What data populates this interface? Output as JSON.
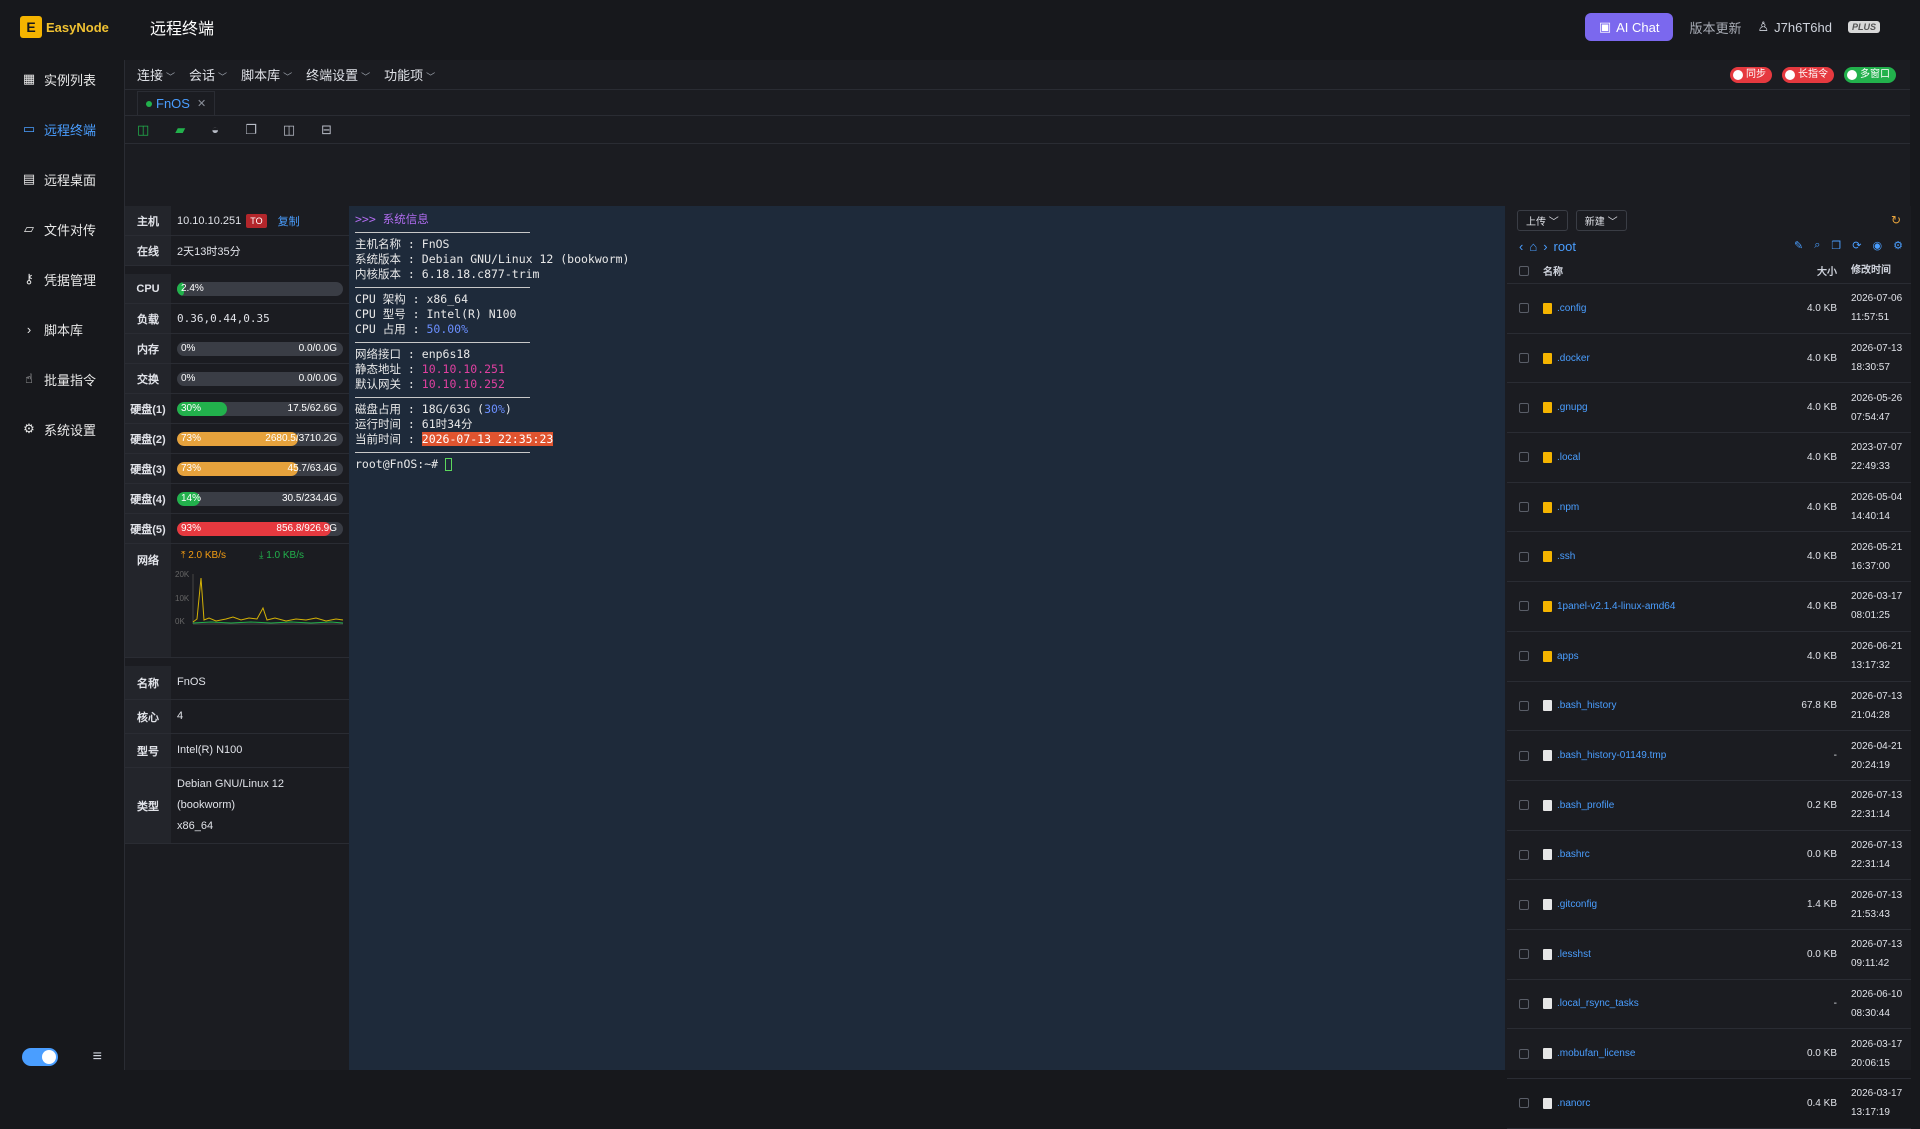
{
  "app": {
    "logo": "EasyNode",
    "logo_mark": "E",
    "title": "远程终端"
  },
  "topbar": {
    "ai_label": "AI Chat",
    "update_label": "版本更新",
    "user": "J7h6T6hd",
    "plan": "PLUS"
  },
  "sidebar": {
    "items": [
      {
        "label": "实例列表",
        "icon": "grid-icon"
      },
      {
        "label": "远程终端",
        "icon": "terminal-icon"
      },
      {
        "label": "远程桌面",
        "icon": "desktop-icon"
      },
      {
        "label": "文件对传",
        "icon": "folder-icon"
      },
      {
        "label": "凭据管理",
        "icon": "key-icon"
      },
      {
        "label": "脚本库",
        "icon": "chevron-right-icon"
      },
      {
        "label": "批量指令",
        "icon": "hand-icon"
      },
      {
        "label": "系统设置",
        "icon": "gear-icon"
      }
    ]
  },
  "menubar": {
    "items": [
      "连接",
      "会话",
      "脚本库",
      "终端设置",
      "功能项"
    ],
    "pills": [
      {
        "label": "同步",
        "on": false
      },
      {
        "label": "长指令",
        "on": false
      },
      {
        "label": "多窗口",
        "on": true
      }
    ]
  },
  "tab": {
    "label": "FnOS"
  },
  "host": {
    "host_label": "主机",
    "host": "10.10.10.251",
    "to": "TO",
    "copy": "复制",
    "online_label": "在线",
    "online": "2天13时35分",
    "cpu_label": "CPU",
    "cpu_pct": "2.4%",
    "load_label": "负载",
    "load": "0.36,0.44,0.35",
    "mem_label": "内存",
    "mem_pct": "0%",
    "mem_amt": "0.0/0.0G",
    "swap_label": "交换",
    "swap_pct": "0%",
    "swap_amt": "0.0/0.0G",
    "disks": [
      {
        "label": "硬盘(1)",
        "pct": "30%",
        "amt": "17.5/62.6G",
        "fill": 0.3,
        "color": "#22b14c"
      },
      {
        "label": "硬盘(2)",
        "pct": "73%",
        "amt": "2680.5/3710.2G",
        "fill": 0.73,
        "color": "#e6a23c"
      },
      {
        "label": "硬盘(3)",
        "pct": "73%",
        "amt": "45.7/63.4G",
        "fill": 0.73,
        "color": "#e6a23c"
      },
      {
        "label": "硬盘(4)",
        "pct": "14%",
        "amt": "30.5/234.4G",
        "fill": 0.14,
        "color": "#22b14c"
      },
      {
        "label": "硬盘(5)",
        "pct": "93%",
        "amt": "856.8/926.9G",
        "fill": 0.93,
        "color": "#e6393f"
      }
    ],
    "net_label": "网络",
    "net_up": "2.0 KB/s",
    "net_down": "1.0 KB/s",
    "net_ticks": [
      "20K",
      "10K",
      "0K"
    ]
  },
  "info": {
    "name_label": "名称",
    "name": "FnOS",
    "cores_label": "核心",
    "cores": "4",
    "model_label": "型号",
    "model": "Intel(R) N100",
    "type_label": "类型",
    "type": "Debian GNU/Linux 12 (bookworm)",
    "arch": "x86_64"
  },
  "terminal": {
    "header": ">>> 系统信息",
    "host_name": "主机名称 : FnOS",
    "os": "系统版本 : Debian GNU/Linux 12 (bookworm)",
    "kernel": "内核版本 : 6.18.18.c877-trim",
    "cpu_arch": "CPU 架构 : x86_64",
    "cpu_model": "CPU 型号 : Intel(R) N100",
    "cpu_use_label": "CPU 占用 : ",
    "cpu_use": "50.00%",
    "iface": "网络接口 : enp6s18",
    "ip_label": "静态地址 : ",
    "ip": "10.10.10.251",
    "gw_label": "默认网关 : ",
    "gw": "10.10.10.252",
    "disk_label": "磁盘占用 : 18G/63G (",
    "disk_pct": "30%",
    "disk_end": ")",
    "uptime": "运行时间 : 61时34分",
    "now_label": "当前时间 : ",
    "now": "2026-07-13 22:35:23",
    "prompt": "root@FnOS:~# "
  },
  "files": {
    "upload": "上传",
    "new": "新建",
    "path": "root",
    "col_name": "名称",
    "col_size": "大小",
    "col_time": "修改时间",
    "rows": [
      {
        "name": ".config",
        "type": "dir",
        "size": "4.0 KB",
        "date": "2026-07-06",
        "time": "11:57:51"
      },
      {
        "name": ".docker",
        "type": "dir",
        "size": "4.0 KB",
        "date": "2026-07-13",
        "time": "18:30:57"
      },
      {
        "name": ".gnupg",
        "type": "dir",
        "size": "4.0 KB",
        "date": "2026-05-26",
        "time": "07:54:47"
      },
      {
        "name": ".local",
        "type": "dir",
        "size": "4.0 KB",
        "date": "2023-07-07",
        "time": "22:49:33"
      },
      {
        "name": ".npm",
        "type": "dir",
        "size": "4.0 KB",
        "date": "2026-05-04",
        "time": "14:40:14"
      },
      {
        "name": ".ssh",
        "type": "dir",
        "size": "4.0 KB",
        "date": "2026-05-21",
        "time": "16:37:00"
      },
      {
        "name": "1panel-v2.1.4-linux-amd64",
        "type": "dir",
        "size": "4.0 KB",
        "date": "2026-03-17",
        "time": "08:01:25"
      },
      {
        "name": "apps",
        "type": "dir",
        "size": "4.0 KB",
        "date": "2026-06-21",
        "time": "13:17:32"
      },
      {
        "name": ".bash_history",
        "type": "file",
        "size": "67.8 KB",
        "date": "2026-07-13",
        "time": "21:04:28"
      },
      {
        "name": ".bash_history-01149.tmp",
        "type": "file",
        "size": "-",
        "date": "2026-04-21",
        "time": "20:24:19"
      },
      {
        "name": ".bash_profile",
        "type": "file",
        "size": "0.2 KB",
        "date": "2026-07-13",
        "time": "22:31:14"
      },
      {
        "name": ".bashrc",
        "type": "file",
        "size": "0.0 KB",
        "date": "2026-07-13",
        "time": "22:31:14"
      },
      {
        "name": ".gitconfig",
        "type": "file",
        "size": "1.4 KB",
        "date": "2026-07-13",
        "time": "21:53:43"
      },
      {
        "name": ".lesshst",
        "type": "file",
        "size": "0.0 KB",
        "date": "2026-07-13",
        "time": "09:11:42"
      },
      {
        "name": ".local_rsync_tasks",
        "type": "file",
        "size": "-",
        "date": "2026-06-10",
        "time": "08:30:44"
      },
      {
        "name": ".mobufan_license",
        "type": "file",
        "size": "0.0 KB",
        "date": "2026-03-17",
        "time": "20:06:15"
      },
      {
        "name": ".nanorc",
        "type": "file",
        "size": "0.4 KB",
        "date": "2026-03-17",
        "time": "13:17:19"
      }
    ]
  }
}
